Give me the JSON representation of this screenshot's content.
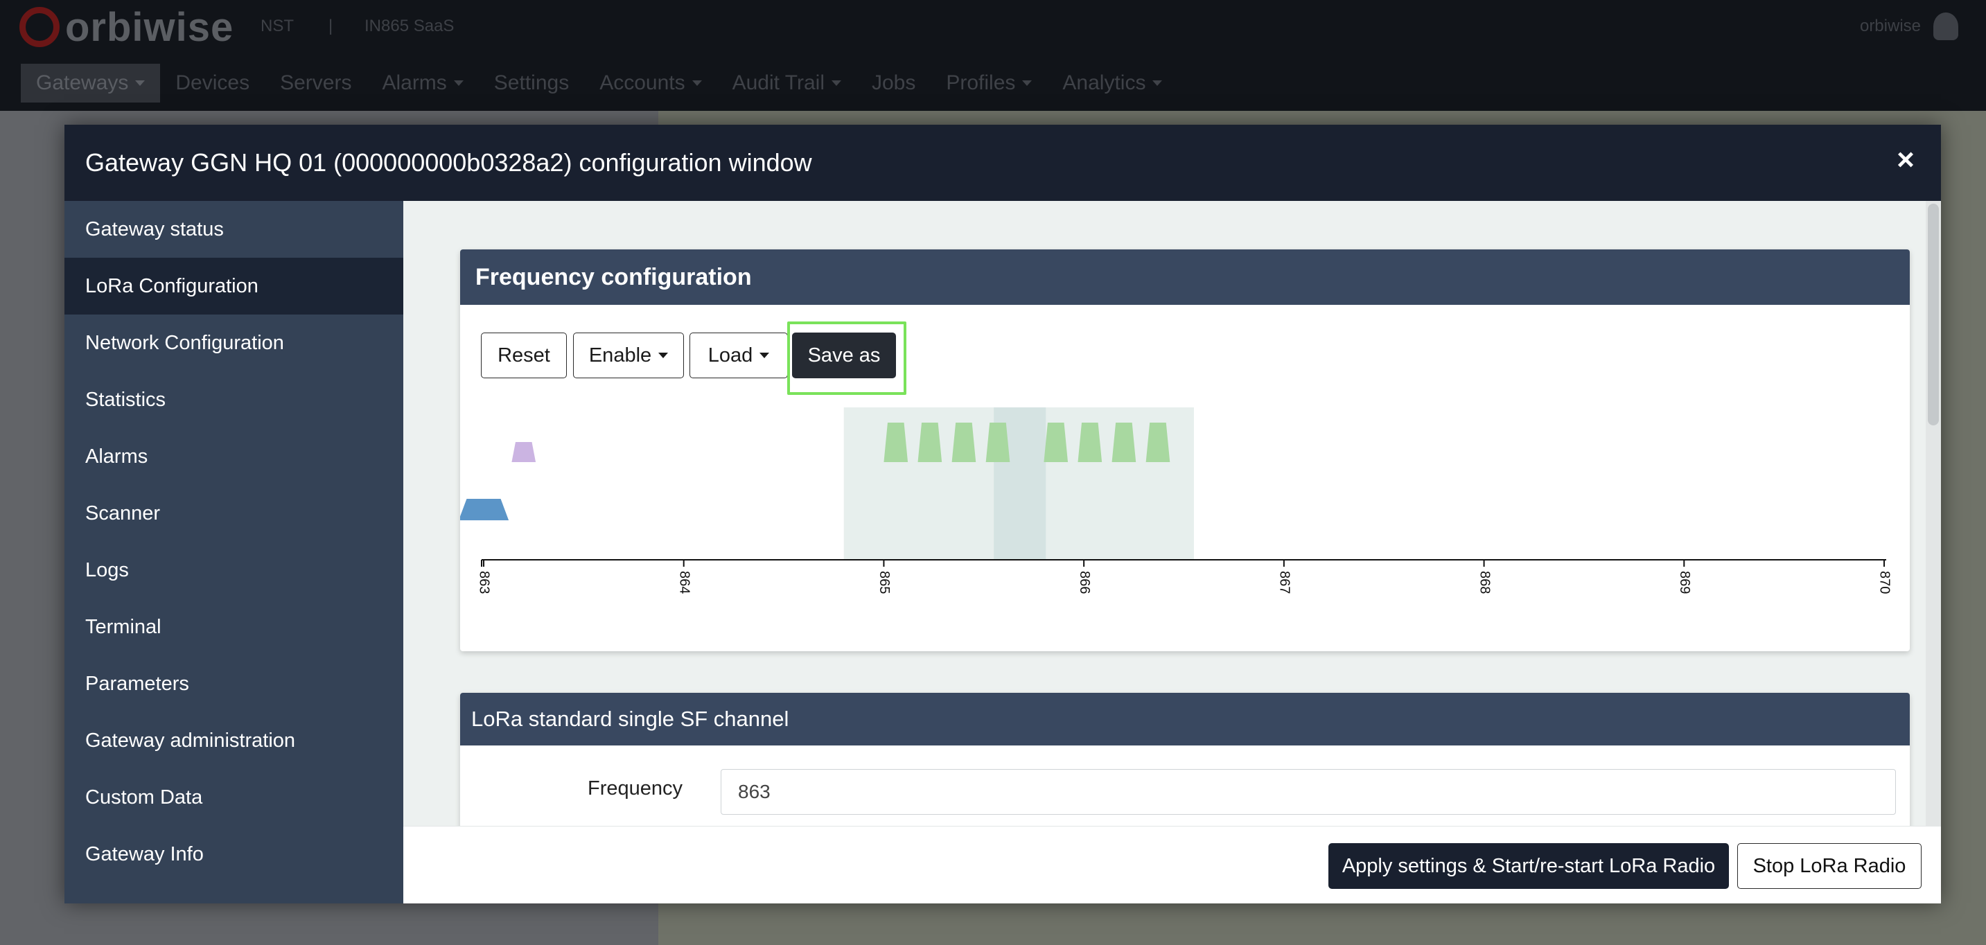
{
  "app": {
    "brand": "orbiwise",
    "meta": [
      "NST",
      "|",
      "IN865 SaaS"
    ],
    "user": "orbiwise",
    "nav": [
      {
        "label": "Gateways",
        "caret": true
      },
      {
        "label": "Devices",
        "caret": false
      },
      {
        "label": "Servers",
        "caret": false
      },
      {
        "label": "Alarms",
        "caret": true
      },
      {
        "label": "Settings",
        "caret": false
      },
      {
        "label": "Accounts",
        "caret": true
      },
      {
        "label": "Audit Trail",
        "caret": true
      },
      {
        "label": "Jobs",
        "caret": false
      },
      {
        "label": "Profiles",
        "caret": true
      },
      {
        "label": "Analytics",
        "caret": true
      }
    ]
  },
  "modal": {
    "title": "Gateway GGN HQ 01 (000000000b0328a2) configuration window",
    "close_glyph": "×",
    "sidebar": [
      "Gateway status",
      "LoRa Configuration",
      "Network Configuration",
      "Statistics",
      "Alarms",
      "Scanner",
      "Logs",
      "Terminal",
      "Parameters",
      "Gateway administration",
      "Custom Data",
      "Gateway Info"
    ],
    "active_sidebar": "LoRa Configuration",
    "freq_card": {
      "title": "Frequency configuration",
      "buttons": {
        "reset": "Reset",
        "enable": "Enable",
        "load": "Load",
        "save_as": "Save as"
      }
    },
    "sf_card": {
      "title": "LoRa standard single SF channel",
      "frequency_label": "Frequency",
      "frequency_value": "863"
    },
    "footer": {
      "apply": "Apply settings & Start/re-start LoRa Radio",
      "stop": "Stop LoRa Radio"
    }
  },
  "chart_data": {
    "type": "frequency-plan",
    "x_ticks": [
      "863",
      "864",
      "865",
      "866",
      "867",
      "868",
      "869",
      "870"
    ],
    "xlim": [
      863,
      870
    ],
    "bands": [
      {
        "from": 864.8,
        "to": 866.55,
        "color": "#e7efed"
      },
      {
        "from": 865.55,
        "to": 865.81,
        "color": "#d5e3e2"
      }
    ],
    "channels": [
      {
        "freq": 863.0,
        "level": "low",
        "color": "#5b95c8",
        "width": 0.25
      },
      {
        "freq": 863.2,
        "level": "mid",
        "color": "#cbb4e2",
        "width": 0.12
      },
      {
        "freq": 865.06,
        "level": "high",
        "color": "#a8d8a0",
        "width": 0.12
      },
      {
        "freq": 865.23,
        "level": "high",
        "color": "#a8d8a0",
        "width": 0.12
      },
      {
        "freq": 865.4,
        "level": "high",
        "color": "#a8d8a0",
        "width": 0.12
      },
      {
        "freq": 865.57,
        "level": "high",
        "color": "#a8d8a0",
        "width": 0.12
      },
      {
        "freq": 865.86,
        "level": "high",
        "color": "#a8d8a0",
        "width": 0.12
      },
      {
        "freq": 866.03,
        "level": "high",
        "color": "#a8d8a0",
        "width": 0.12
      },
      {
        "freq": 866.2,
        "level": "high",
        "color": "#a8d8a0",
        "width": 0.12
      },
      {
        "freq": 866.37,
        "level": "high",
        "color": "#a8d8a0",
        "width": 0.12
      }
    ]
  },
  "colors": {
    "header": "#19202f",
    "sidebar": "#344256",
    "sidebar_active": "#1b2434",
    "card_head": "#394860",
    "highlight": "#7ae25a"
  }
}
